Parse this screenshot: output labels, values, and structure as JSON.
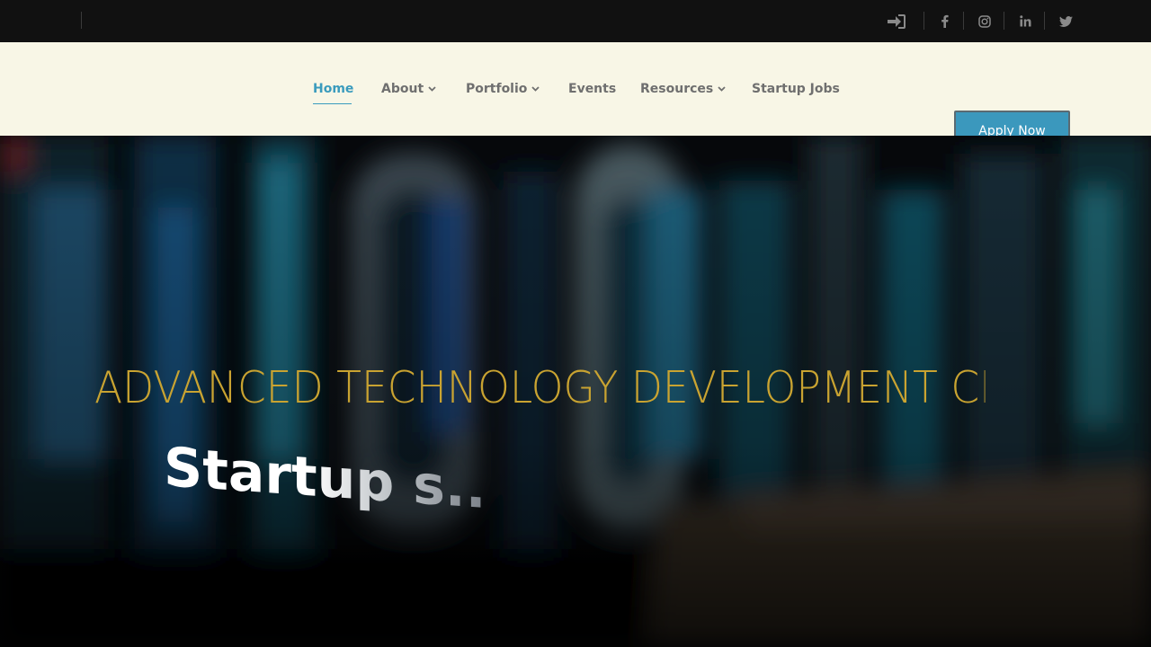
{
  "topbar": {
    "icons": [
      {
        "name": "sign-in-icon",
        "glyph": "➜"
      },
      {
        "name": "facebook-icon",
        "glyph": "f"
      },
      {
        "name": "instagram-icon",
        "glyph": "◎"
      },
      {
        "name": "linkedin-icon",
        "glyph": "in"
      },
      {
        "name": "twitter-icon",
        "glyph": "🐦"
      }
    ]
  },
  "nav": {
    "items": [
      {
        "label": "Home",
        "active": true,
        "dropdown": false
      },
      {
        "label": "About",
        "active": false,
        "dropdown": true
      },
      {
        "label": "Portfolio",
        "active": false,
        "dropdown": true
      },
      {
        "label": "Events",
        "active": false,
        "dropdown": false
      },
      {
        "label": "Resources",
        "active": false,
        "dropdown": true
      },
      {
        "label": "Startup Jobs",
        "active": false,
        "dropdown": false
      }
    ],
    "cta_label": "Apply Now"
  },
  "hero": {
    "title": "ADVANCED TECHNOLOGY DEVELOPMENT CENTE",
    "animated_word": "Startup s.."
  },
  "colors": {
    "topbar_bg": "#111111",
    "nav_bg": "#f8f6e6",
    "accent": "#3a9bbd",
    "hero_title": "#c9a331"
  }
}
